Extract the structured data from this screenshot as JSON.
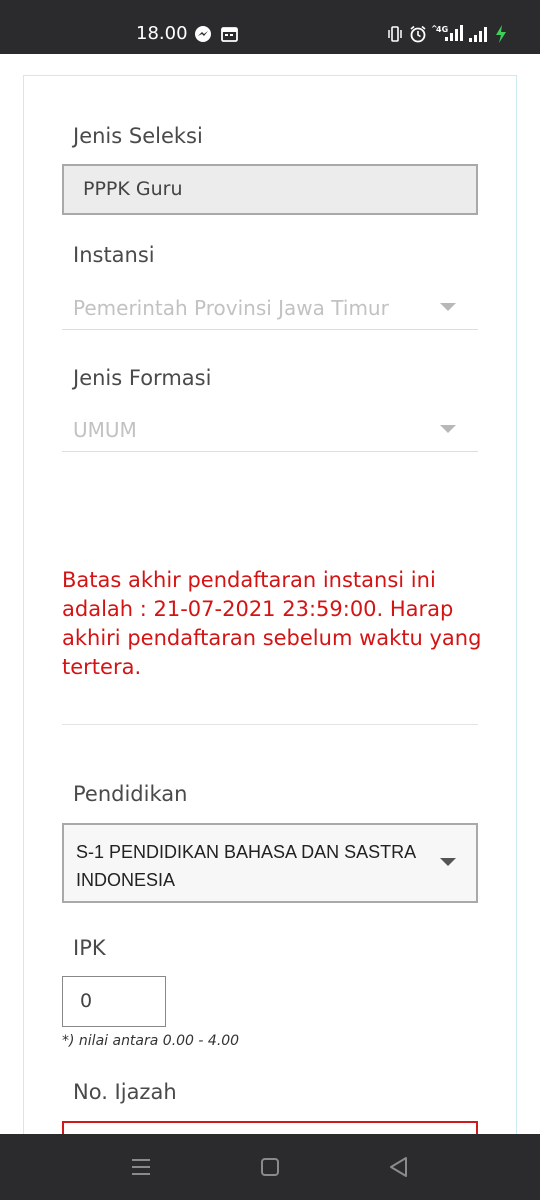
{
  "status_bar": {
    "time": "18.00",
    "network": "4G"
  },
  "form": {
    "jenis_seleksi": {
      "label": "Jenis Seleksi",
      "value": "PPPK Guru"
    },
    "instansi": {
      "label": "Instansi",
      "value": "Pemerintah Provinsi Jawa Timur"
    },
    "jenis_formasi": {
      "label": "Jenis Formasi",
      "value": "UMUM"
    },
    "warning": "Batas akhir pendaftaran instansi ini adalah : 21-07-2021 23:59:00. Harap akhiri pendaftaran sebelum waktu yang tertera.",
    "pendidikan": {
      "label": "Pendidikan",
      "value": "S-1 PENDIDIKAN BAHASA DAN SASTRA INDONESIA"
    },
    "ipk": {
      "label": "IPK",
      "value": "0",
      "hint": "*) nilai antara 0.00 - 4.00"
    },
    "no_ijazah": {
      "label": "No. Ijazah",
      "value": ""
    }
  },
  "colors": {
    "warning": "#d41414",
    "error_border": "#d01a1a",
    "card_border": "#cdeaf2",
    "bars": "#2b2b2d"
  },
  "icons": {
    "status_left": [
      "messenger-icon",
      "calendar-icon"
    ],
    "status_right": [
      "vibrate-icon",
      "alarm-icon",
      "signal-4g-icon",
      "signal-icon",
      "charging-icon"
    ],
    "navigation": [
      "recent-apps-icon",
      "home-icon",
      "back-icon"
    ]
  }
}
